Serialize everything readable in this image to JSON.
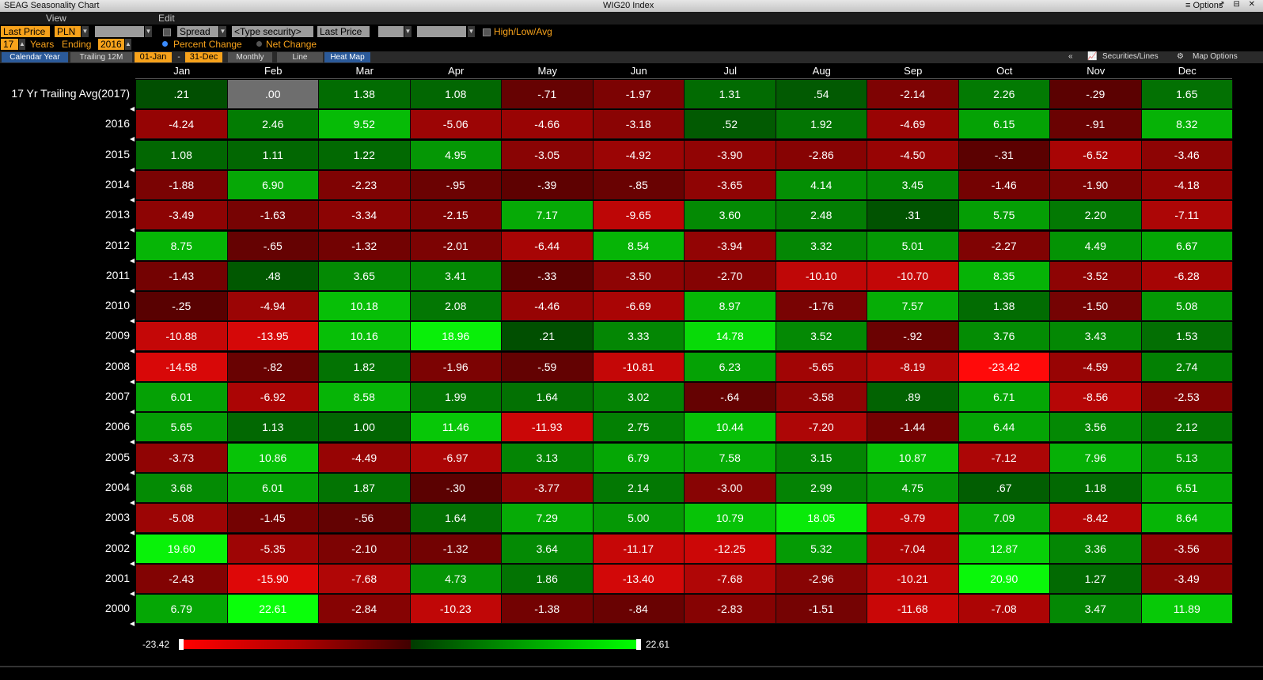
{
  "titlebar": {
    "title": "SEAG Seasonality Chart",
    "security": "WIG20 Index",
    "options": "≡ Options",
    "window_buttons": "↗ ⊟ ✕"
  },
  "menu": {
    "view": "View",
    "edit": "Edit"
  },
  "toolbar": {
    "field": "Last Price",
    "currency": "PLN",
    "spread": "Spread",
    "security_placeholder": "<Type security>",
    "compare_field": "Last Price",
    "hla_label": "High/Low/Avg",
    "years": "17",
    "years_label": "Years",
    "ending_label": "Ending",
    "ending_year": "2016",
    "percent_change": "Percent Change",
    "net_change": "Net Change"
  },
  "tabs": {
    "calendar_year": "Calendar Year",
    "trailing_12m": "Trailing 12M",
    "start_date": "01-Jan",
    "dash": "-",
    "end_date": "31-Dec",
    "period": "Monthly",
    "line": "Line",
    "heat_map": "Heat Map",
    "collapse": "«",
    "securities_lines": "Securities/Lines",
    "map_options": "Map Options"
  },
  "colors": {
    "accent_orange": "#f7a21b",
    "active_tab": "#2b5a9a",
    "min_color": "#ff0000",
    "max_color": "#00ff00"
  },
  "chart_data": {
    "type": "heatmap",
    "columns": [
      "Jan",
      "Feb",
      "Mar",
      "Apr",
      "May",
      "Jun",
      "Jul",
      "Aug",
      "Sep",
      "Oct",
      "Nov",
      "Dec"
    ],
    "rows": [
      {
        "label": "17 Yr Trailing Avg(2017)",
        "values": [
          ".21",
          ".00",
          "1.38",
          "1.08",
          "-.71",
          "-1.97",
          "1.31",
          ".54",
          "-2.14",
          "2.26",
          "-.29",
          "1.65"
        ]
      },
      {
        "label": "2016",
        "values": [
          "-4.24",
          "2.46",
          "9.52",
          "-5.06",
          "-4.66",
          "-3.18",
          ".52",
          "1.92",
          "-4.69",
          "6.15",
          "-.91",
          "8.32"
        ]
      },
      {
        "label": "2015",
        "values": [
          "1.08",
          "1.11",
          "1.22",
          "4.95",
          "-3.05",
          "-4.92",
          "-3.90",
          "-2.86",
          "-4.50",
          "-.31",
          "-6.52",
          "-3.46"
        ]
      },
      {
        "label": "2014",
        "values": [
          "-1.88",
          "6.90",
          "-2.23",
          "-.95",
          "-.39",
          "-.85",
          "-3.65",
          "4.14",
          "3.45",
          "-1.46",
          "-1.90",
          "-4.18"
        ]
      },
      {
        "label": "2013",
        "values": [
          "-3.49",
          "-1.63",
          "-3.34",
          "-2.15",
          "7.17",
          "-9.65",
          "3.60",
          "2.48",
          ".31",
          "5.75",
          "2.20",
          "-7.11"
        ]
      },
      {
        "label": "2012",
        "values": [
          "8.75",
          "-.65",
          "-1.32",
          "-2.01",
          "-6.44",
          "8.54",
          "-3.94",
          "3.32",
          "5.01",
          "-2.27",
          "4.49",
          "6.67"
        ]
      },
      {
        "label": "2011",
        "values": [
          "-1.43",
          ".48",
          "3.65",
          "3.41",
          "-.33",
          "-3.50",
          "-2.70",
          "-10.10",
          "-10.70",
          "8.35",
          "-3.52",
          "-6.28"
        ]
      },
      {
        "label": "2010",
        "values": [
          "-.25",
          "-4.94",
          "10.18",
          "2.08",
          "-4.46",
          "-6.69",
          "8.97",
          "-1.76",
          "7.57",
          "1.38",
          "-1.50",
          "5.08"
        ]
      },
      {
        "label": "2009",
        "values": [
          "-10.88",
          "-13.95",
          "10.16",
          "18.96",
          ".21",
          "3.33",
          "14.78",
          "3.52",
          "-.92",
          "3.76",
          "3.43",
          "1.53"
        ]
      },
      {
        "label": "2008",
        "values": [
          "-14.58",
          "-.82",
          "1.82",
          "-1.96",
          "-.59",
          "-10.81",
          "6.23",
          "-5.65",
          "-8.19",
          "-23.42",
          "-4.59",
          "2.74"
        ]
      },
      {
        "label": "2007",
        "values": [
          "6.01",
          "-6.92",
          "8.58",
          "1.99",
          "1.64",
          "3.02",
          "-.64",
          "-3.58",
          ".89",
          "6.71",
          "-8.56",
          "-2.53"
        ]
      },
      {
        "label": "2006",
        "values": [
          "5.65",
          "1.13",
          "1.00",
          "11.46",
          "-11.93",
          "2.75",
          "10.44",
          "-7.20",
          "-1.44",
          "6.44",
          "3.56",
          "2.12"
        ]
      },
      {
        "label": "2005",
        "values": [
          "-3.73",
          "10.86",
          "-4.49",
          "-6.97",
          "3.13",
          "6.79",
          "7.58",
          "3.15",
          "10.87",
          "-7.12",
          "7.96",
          "5.13"
        ]
      },
      {
        "label": "2004",
        "values": [
          "3.68",
          "6.01",
          "1.87",
          "-.30",
          "-3.77",
          "2.14",
          "-3.00",
          "2.99",
          "4.75",
          ".67",
          "1.18",
          "6.51"
        ]
      },
      {
        "label": "2003",
        "values": [
          "-5.08",
          "-1.45",
          "-.56",
          "1.64",
          "7.29",
          "5.00",
          "10.79",
          "18.05",
          "-9.79",
          "7.09",
          "-8.42",
          "8.64"
        ]
      },
      {
        "label": "2002",
        "values": [
          "19.60",
          "-5.35",
          "-2.10",
          "-1.32",
          "3.64",
          "-11.17",
          "-12.25",
          "5.32",
          "-7.04",
          "12.87",
          "3.36",
          "-3.56"
        ]
      },
      {
        "label": "2001",
        "values": [
          "-2.43",
          "-15.90",
          "-7.68",
          "4.73",
          "1.86",
          "-13.40",
          "-7.68",
          "-2.96",
          "-10.21",
          "20.90",
          "1.27",
          "-3.49"
        ]
      },
      {
        "label": "2000",
        "values": [
          "6.79",
          "22.61",
          "-2.84",
          "-10.23",
          "-1.38",
          "-.84",
          "-2.83",
          "-1.51",
          "-11.68",
          "-7.08",
          "3.47",
          "11.89"
        ]
      }
    ],
    "min": "-23.42",
    "max": "22.61",
    "zero_cell_color": "#6e6e6e"
  }
}
